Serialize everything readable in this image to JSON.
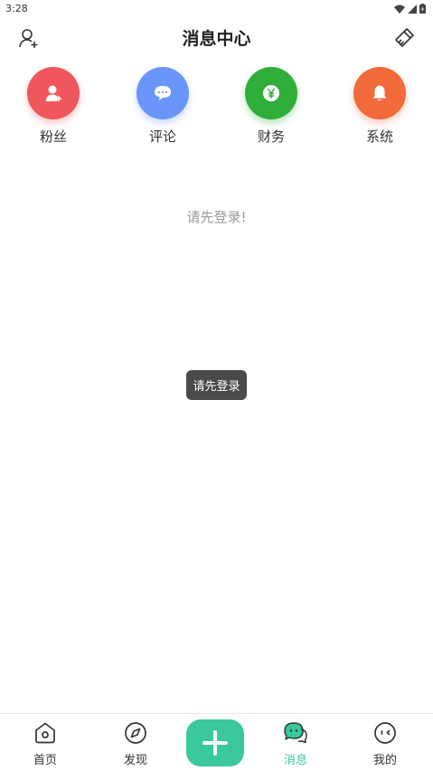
{
  "status_bar": {
    "time": "3:28"
  },
  "header": {
    "title": "消息中心"
  },
  "categories": [
    {
      "label": "粉丝",
      "color": "#f0575c",
      "icon": "person-add-icon"
    },
    {
      "label": "评论",
      "color": "#6a96fb",
      "icon": "chat-bubble-icon"
    },
    {
      "label": "财务",
      "color": "#2fae3a",
      "icon": "yen-coin-icon"
    },
    {
      "label": "系统",
      "color": "#f2693a",
      "icon": "bell-icon"
    }
  ],
  "main": {
    "empty_text": "请先登录!"
  },
  "toast": {
    "text": "请先登录"
  },
  "bottom_nav": {
    "items": [
      {
        "label": "首页",
        "icon": "home-icon",
        "active": false
      },
      {
        "label": "发现",
        "icon": "compass-icon",
        "active": false
      },
      {
        "label": "消息",
        "icon": "message-icon",
        "active": true
      },
      {
        "label": "我的",
        "icon": "profile-face-icon",
        "active": false
      }
    ],
    "add_icon": "plus-icon",
    "accent": "#3ac89c"
  }
}
